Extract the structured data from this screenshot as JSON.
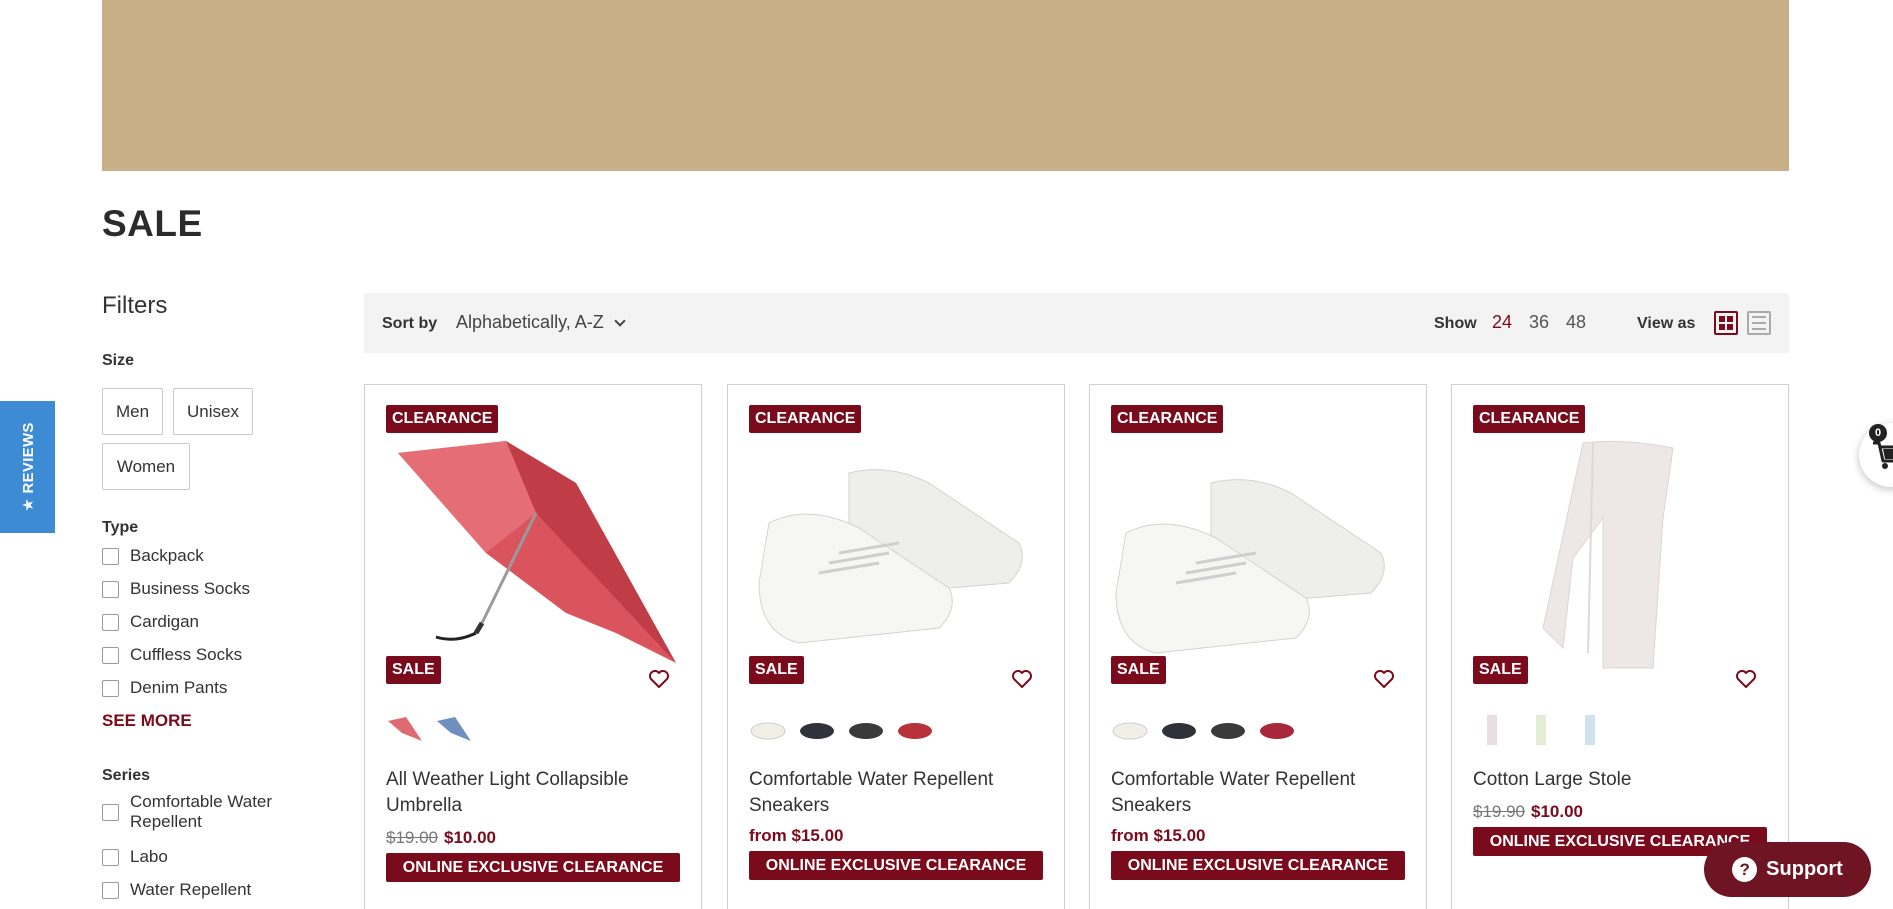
{
  "page": {
    "title": "SALE"
  },
  "reviews_tab": {
    "label": "★ REVIEWS"
  },
  "filters": {
    "title": "Filters",
    "size": {
      "title": "Size",
      "options": [
        "Men",
        "Unisex",
        "Women"
      ]
    },
    "type": {
      "title": "Type",
      "options": [
        "Backpack",
        "Business Socks",
        "Cardigan",
        "Cuffless Socks",
        "Denim Pants"
      ],
      "see_more": "SEE MORE"
    },
    "series": {
      "title": "Series",
      "options": [
        "Comfortable Water Repellent",
        "Labo",
        "Water Repellent"
      ]
    }
  },
  "toolbar": {
    "sort_label": "Sort by",
    "sort_value": "Alphabetically, A-Z",
    "show_label": "Show",
    "show_options": [
      "24",
      "36",
      "48"
    ],
    "show_active": "24",
    "view_label": "View as",
    "view_active": "grid"
  },
  "products": [
    {
      "badge_top": "CLEARANCE",
      "badge_sale": "SALE",
      "title": "All Weather Light Collapsible Umbrella",
      "price_old": "$19.00",
      "price_new": "$10.00",
      "price_prefix": "",
      "banner": "ONLINE EXCLUSIVE CLEARANCE",
      "swatch_colors": [
        "#e06a72",
        "#6f8fc0"
      ]
    },
    {
      "badge_top": "CLEARANCE",
      "badge_sale": "SALE",
      "title": "Comfortable Water Repellent Sneakers",
      "price_old": "",
      "price_new": "from $15.00",
      "banner": "ONLINE EXCLUSIVE CLEARANCE",
      "swatch_colors": [
        "#f1efe8",
        "#2f3238",
        "#3a3a3a",
        "#b8323c"
      ]
    },
    {
      "badge_top": "CLEARANCE",
      "badge_sale": "SALE",
      "title": "Comfortable Water Repellent Sneakers",
      "price_old": "",
      "price_new": "from $15.00",
      "banner": "ONLINE EXCLUSIVE CLEARANCE",
      "swatch_colors": [
        "#f1efe8",
        "#2f3238",
        "#3a3a3a",
        "#a8283a"
      ]
    },
    {
      "badge_top": "CLEARANCE",
      "badge_sale": "SALE",
      "title": "Cotton Large Stole",
      "price_old": "$19.90",
      "price_new": "$10.00",
      "banner": "ONLINE EXCLUSIVE CLEARANCE",
      "swatch_colors": [
        "#e9dfe0",
        "#e4ecd5",
        "#cfe1ec"
      ]
    }
  ],
  "cart": {
    "count": "0",
    "icon": "cart-icon"
  },
  "support": {
    "label": "Support"
  },
  "colors": {
    "accent": "#7a0b1c",
    "banner": "#c8af87",
    "reviews": "#3d8bd4",
    "toolbar_bg": "#f3f3f3"
  }
}
